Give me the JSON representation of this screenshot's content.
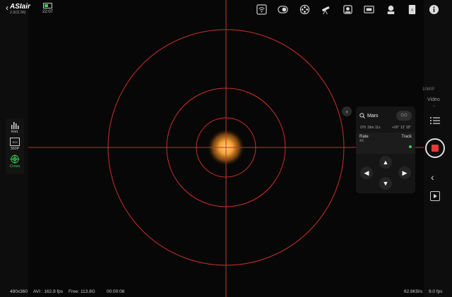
{
  "app": {
    "title": "ASIair",
    "version": "2.3(11.56)",
    "battery_level": 0.5,
    "time": "22:07"
  },
  "colors": {
    "reticle": "#c8302e",
    "accent_green": "#39d353",
    "record_red": "#e53935",
    "planet": "#f0a030"
  },
  "top_icons": [
    "wifi-icon",
    "camera-icon",
    "filter-wheel-icon",
    "telescope-icon",
    "focuser-icon",
    "guide-camera-icon",
    "rotator-icon",
    "storage-icon",
    "info-icon"
  ],
  "left_tools": {
    "hist_label": "Hist.",
    "roi_label": "ROI",
    "roi_value": "360P",
    "cross_label": "Cross"
  },
  "goto": {
    "target": "Mars",
    "go_label": "GO",
    "ra": "07h 19m 11s",
    "dec": "+26° 13' 18\"",
    "rate_label": "Rate",
    "rate_value": "4X",
    "track_label": "Track",
    "tracking": true
  },
  "right_panel": {
    "resolution": "1080P",
    "mode": "Video"
  },
  "status": {
    "resolution": "480x360",
    "avi_fps": "AVI : 162.8 fps",
    "free": "Free: 113.8G",
    "elapsed": "00:00:08",
    "transfer_rate": "62.8KB/s",
    "display_fps": "9.0 fps"
  }
}
